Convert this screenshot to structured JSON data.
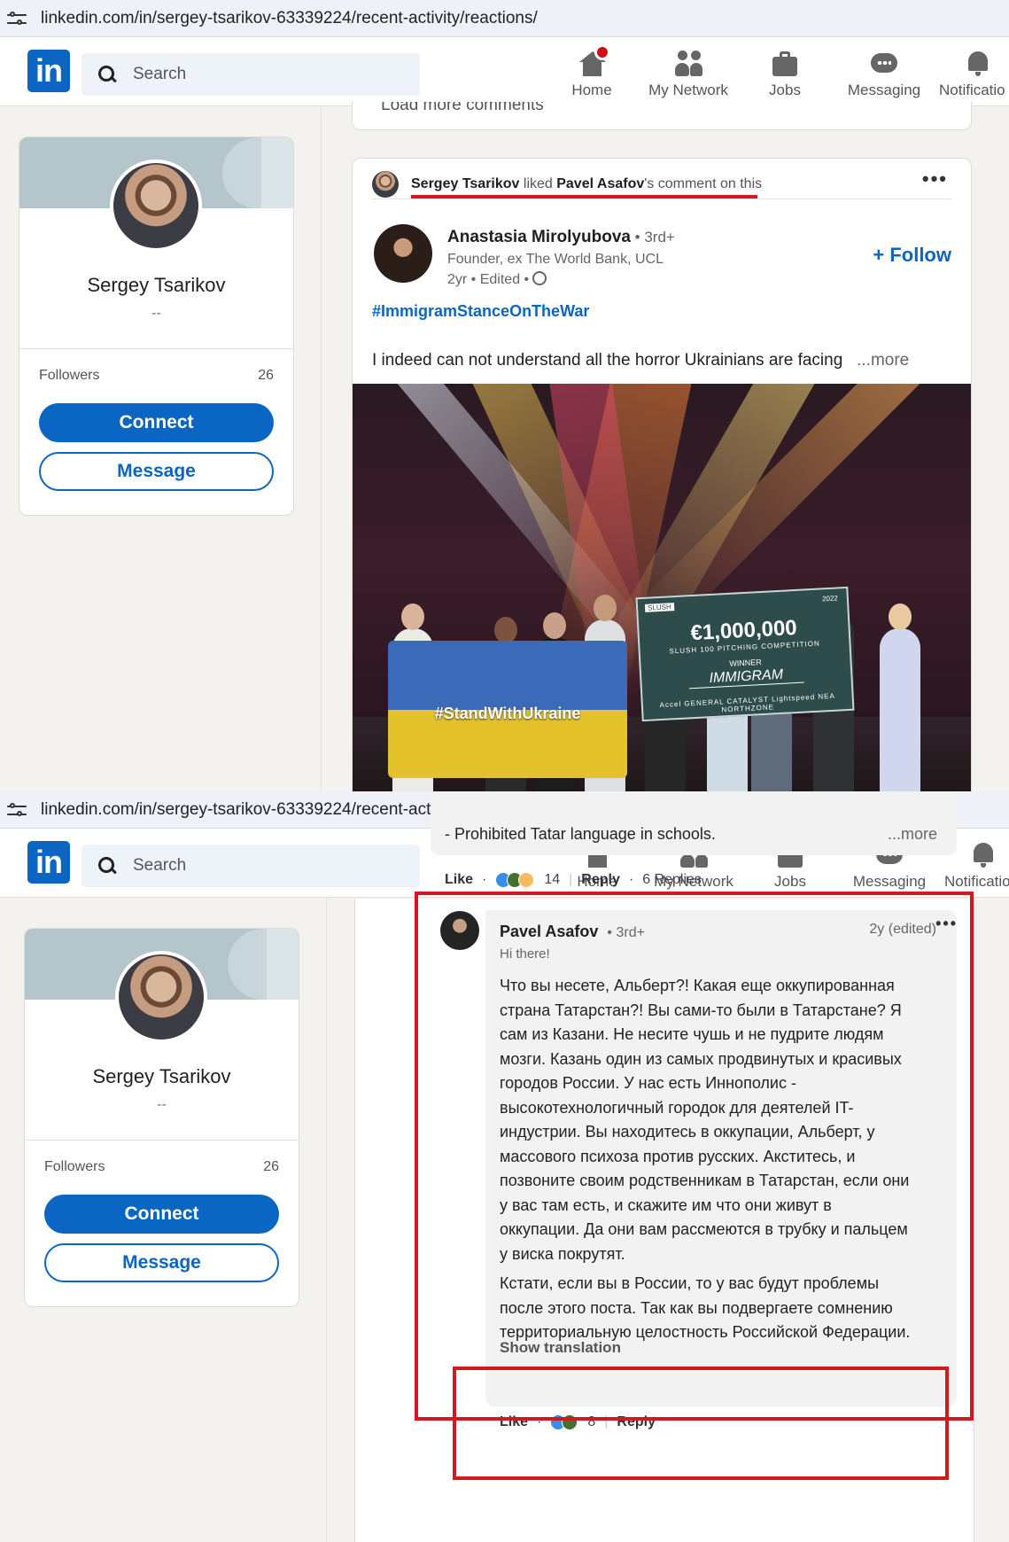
{
  "shot1": {
    "url": "linkedin.com/in/sergey-tsarikov-63339224/recent-activity/reactions/",
    "nav": {
      "search_placeholder": "Search",
      "home": "Home",
      "network": "My Network",
      "jobs": "Jobs",
      "messaging": "Messaging",
      "notifications": "Notificatio"
    },
    "profile": {
      "name": "Sergey Tsarikov",
      "headline": "--",
      "followers_label": "Followers",
      "followers_count": "26",
      "connect": "Connect",
      "message": "Message"
    },
    "load_more": "Load more comments",
    "post": {
      "activity_actor": "Sergey Tsarikov",
      "activity_mid": " liked ",
      "activity_target": "Pavel Asafov",
      "activity_tail": "'s comment on this",
      "author_name": "Anastasia Mirolyubova",
      "author_degree": " • 3rd+",
      "author_headline": "Founder, ex The World Bank, UCL",
      "author_time": "2yr • Edited •",
      "follow": "+ Follow",
      "hashtag": "#ImmigramStanceOnTheWar",
      "text": "I indeed can not understand all the horror Ukrainians are facing",
      "see_more": "...more",
      "image": {
        "flag_text": "#StandWithUkraine",
        "cheque_amount": "€1,000,000",
        "cheque_line1": "SLUSH 100 PITCHING COMPETITION",
        "cheque_winner": "WINNER",
        "cheque_name": "IMMIGRAM",
        "cheque_sponsors": "Accel  GENERAL CATALYST  Lightspeed  NEA  NORTHZONE",
        "cheque_brand": "SLUSH",
        "cheque_year": "2022"
      }
    }
  },
  "shot2": {
    "url": "linkedin.com/in/sergey-tsarikov-63339224/recent-activity/reactions/",
    "nav": {
      "search_placeholder": "Search",
      "home": "Home",
      "network": "My Network",
      "jobs": "Jobs",
      "messaging": "Messaging",
      "notifications": "Notificatio"
    },
    "profile": {
      "name": "Sergey Tsarikov",
      "headline": "--",
      "followers_label": "Followers",
      "followers_count": "26",
      "connect": "Connect",
      "message": "Message"
    },
    "prev_comment": {
      "text": "- Prohibited Tatar language in schools.",
      "more": "...more",
      "like": "Like",
      "react_count": "14",
      "reply": "Reply",
      "replies": "6 Replies"
    },
    "comment": {
      "author": "Pavel Asafov",
      "degree": "• 3rd+",
      "time": "2y (edited)",
      "headline": "Hi there!",
      "body_lines": [
        "Что вы несете, Альберт?! Какая еще оккупированная",
        "страна Татарстан?! Вы сами-то были в Татарстане? Я",
        "сам из Казани. Не несите чушь и не пудрите людям",
        "мозги. Казань один из самых продвинутых и красивых",
        "городов России. У нас есть Иннополис -",
        "высокотехнологичный городок для деятелей IT-",
        "индустрии. Вы находитесь в оккупации, Альберт, у",
        "массового психоза против русских. Акститесь, и",
        "позвоните своим родственникам в Татарстан, если они",
        "у вас там есть, и скажите им что они живут в",
        "оккупации. Да они вам рассмеются в трубку и пальцем",
        "у виска покрутят."
      ],
      "body2_lines": [
        "Кстати, если вы в России, то у вас будут проблемы",
        "после этого поста. Так как вы подвергаете сомнению",
        "территориальную целостность Российской Федерации."
      ],
      "show_translation": "Show translation",
      "like": "Like",
      "react_count": "8",
      "reply": "Reply"
    }
  },
  "colors": {
    "brand": "#0a66c2",
    "annotation_red": "#d2191f",
    "notification": "#cc1016"
  }
}
